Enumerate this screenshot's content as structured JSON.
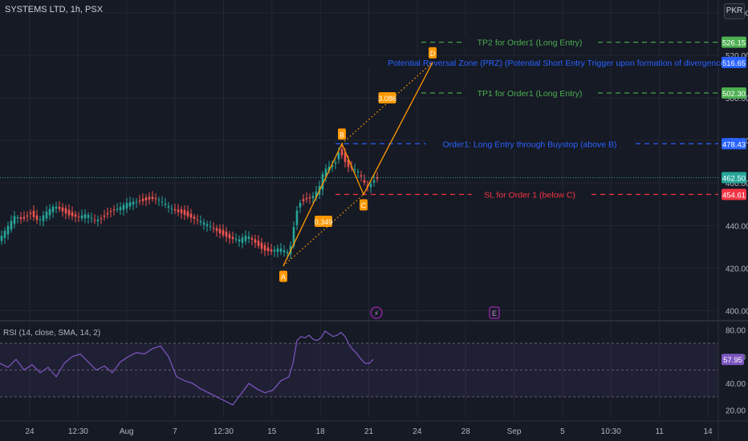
{
  "header": {
    "symbol": "SYSTEMS LTD, 1h, PSX",
    "currency": "PKR"
  },
  "colors": {
    "bg": "#161a25",
    "up": "#26a69a",
    "down": "#ef5350",
    "grid": "#242733",
    "green_line": "#4caf50",
    "blue_line": "#2962ff",
    "red_line": "#f23645",
    "pattern": "#ff9800",
    "rsi": "#7e57c2",
    "axis_text": "#b2b5be"
  },
  "chart_data": {
    "type": "candlestick",
    "price_axis": {
      "ylim": [
        396,
        546
      ],
      "ticks": [
        400,
        420,
        440,
        460,
        480,
        500,
        520,
        540
      ]
    },
    "x_axis_labels": [
      "24",
      "12:30",
      "Aug",
      "7",
      "12:30",
      "15",
      "18",
      "21",
      "24",
      "28",
      "Sep",
      "5",
      "10:30",
      "11",
      "14"
    ],
    "series_path": [
      [
        0,
        433
      ],
      [
        10,
        438
      ],
      [
        20,
        444
      ],
      [
        30,
        443
      ],
      [
        40,
        446
      ],
      [
        50,
        442
      ],
      [
        60,
        446
      ],
      [
        70,
        449
      ],
      [
        80,
        447
      ],
      [
        90,
        445
      ],
      [
        100,
        444
      ],
      [
        110,
        445
      ],
      [
        120,
        442
      ],
      [
        130,
        444
      ],
      [
        140,
        447
      ],
      [
        150,
        448
      ],
      [
        160,
        450
      ],
      [
        170,
        451
      ],
      [
        180,
        452
      ],
      [
        190,
        453
      ],
      [
        200,
        452
      ],
      [
        210,
        449
      ],
      [
        220,
        447
      ],
      [
        230,
        446
      ],
      [
        240,
        444
      ],
      [
        250,
        442
      ],
      [
        260,
        440
      ],
      [
        270,
        438
      ],
      [
        280,
        436
      ],
      [
        290,
        434
      ],
      [
        300,
        433
      ],
      [
        310,
        435
      ],
      [
        320,
        432
      ],
      [
        330,
        429
      ],
      [
        340,
        428
      ],
      [
        350,
        429
      ],
      [
        360,
        427
      ],
      [
        365,
        431
      ],
      [
        370,
        445
      ],
      [
        375,
        451
      ],
      [
        380,
        452
      ],
      [
        385,
        453
      ],
      [
        390,
        453
      ],
      [
        395,
        455
      ],
      [
        400,
        458
      ],
      [
        405,
        465
      ],
      [
        410,
        467
      ],
      [
        415,
        468
      ],
      [
        420,
        470
      ],
      [
        425,
        476
      ],
      [
        430,
        472
      ],
      [
        435,
        468
      ],
      [
        440,
        467
      ],
      [
        445,
        466
      ],
      [
        450,
        464
      ],
      [
        455,
        460
      ],
      [
        460,
        458
      ],
      [
        465,
        460
      ],
      [
        470,
        462.5
      ]
    ],
    "pattern": {
      "points": [
        {
          "label": "A",
          "x": 353,
          "price": 421
        },
        {
          "label": "B",
          "x": 426,
          "price": 478.43
        },
        {
          "label": "C",
          "x": 453,
          "price": 454.61
        },
        {
          "label": "D",
          "x": 539,
          "price": 516.65
        }
      ],
      "ratios": [
        {
          "value": "0.349",
          "price": 442
        },
        {
          "value": "3.086",
          "price": 500
        }
      ]
    },
    "levels": [
      {
        "label": "TP2 for Order1 (Long Entry)",
        "price": 526.15,
        "value": "526.15",
        "color": "#4caf50"
      },
      {
        "label": "Potential Reversal Zone (PRZ) (Potential Short Entry Trigger upon formation of divergence)",
        "price": 516.65,
        "value": "516.65",
        "color": "#2962ff"
      },
      {
        "label": "TP1 for Order1 (Long Entry)",
        "price": 502.3,
        "value": "502.30",
        "color": "#4caf50"
      },
      {
        "label": "Order1: Long Entry through Buystop (above B)",
        "price": 478.43,
        "value": "478.43",
        "color": "#2962ff"
      },
      {
        "label": "SL for Order 1 (below C)",
        "price": 454.61,
        "value": "454.61",
        "color": "#f23645"
      }
    ],
    "last_price": {
      "price": 462.5,
      "value": "462.50"
    },
    "events": [
      {
        "type": "dividend",
        "label": "⚡"
      },
      {
        "type": "earnings",
        "label": "E"
      }
    ],
    "rsi": {
      "title": "RSI (14, close, SMA, 14, 2)",
      "ylim": [
        15,
        85
      ],
      "ticks": [
        20,
        40,
        60,
        80
      ],
      "bands": [
        30,
        50,
        70
      ],
      "last_value": "57.95",
      "values": [
        [
          0,
          55
        ],
        [
          10,
          52
        ],
        [
          20,
          58
        ],
        [
          30,
          50
        ],
        [
          40,
          54
        ],
        [
          50,
          48
        ],
        [
          60,
          52
        ],
        [
          70,
          45
        ],
        [
          80,
          55
        ],
        [
          90,
          60
        ],
        [
          100,
          62
        ],
        [
          110,
          56
        ],
        [
          120,
          50
        ],
        [
          130,
          53
        ],
        [
          140,
          48
        ],
        [
          150,
          56
        ],
        [
          160,
          60
        ],
        [
          170,
          63
        ],
        [
          180,
          62
        ],
        [
          190,
          66
        ],
        [
          200,
          68
        ],
        [
          210,
          60
        ],
        [
          220,
          45
        ],
        [
          230,
          42
        ],
        [
          240,
          40
        ],
        [
          250,
          36
        ],
        [
          260,
          33
        ],
        [
          270,
          30
        ],
        [
          280,
          27
        ],
        [
          290,
          24
        ],
        [
          300,
          32
        ],
        [
          310,
          40
        ],
        [
          320,
          36
        ],
        [
          330,
          33
        ],
        [
          340,
          35
        ],
        [
          350,
          42
        ],
        [
          360,
          45
        ],
        [
          365,
          55
        ],
        [
          370,
          72
        ],
        [
          375,
          75
        ],
        [
          380,
          74
        ],
        [
          385,
          76
        ],
        [
          390,
          73
        ],
        [
          395,
          72
        ],
        [
          400,
          74
        ],
        [
          405,
          79
        ],
        [
          410,
          77
        ],
        [
          415,
          75
        ],
        [
          420,
          76
        ],
        [
          425,
          78
        ],
        [
          430,
          75
        ],
        [
          435,
          69
        ],
        [
          440,
          65
        ],
        [
          445,
          62
        ],
        [
          450,
          58
        ],
        [
          455,
          55
        ],
        [
          460,
          55
        ],
        [
          465,
          57.95
        ]
      ]
    }
  }
}
